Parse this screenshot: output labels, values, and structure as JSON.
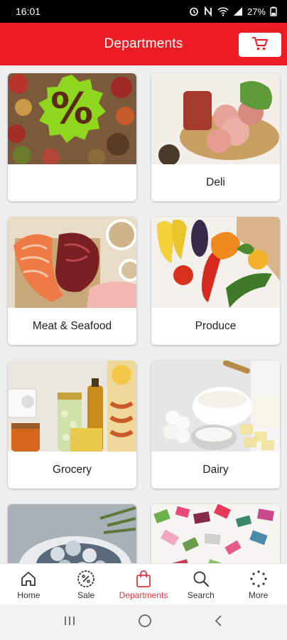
{
  "status_bar": {
    "time": "16:01",
    "battery": "27%"
  },
  "header": {
    "title": "Departments"
  },
  "departments": [
    {
      "label": ""
    },
    {
      "label": "Deli"
    },
    {
      "label": "Meat & Seafood"
    },
    {
      "label": "Produce"
    },
    {
      "label": "Grocery"
    },
    {
      "label": "Dairy"
    },
    {
      "label": ""
    },
    {
      "label": ""
    }
  ],
  "sale_badge": {
    "symbol": "%"
  },
  "bottom_nav": {
    "items": [
      {
        "label": "Home",
        "icon": "home-icon"
      },
      {
        "label": "Sale",
        "icon": "sale-icon"
      },
      {
        "label": "Departments",
        "icon": "bag-icon"
      },
      {
        "label": "Search",
        "icon": "search-icon"
      },
      {
        "label": "More",
        "icon": "more-icon"
      }
    ],
    "active": "Departments"
  },
  "colors": {
    "brand_red": "#ec1c24",
    "active_nav": "#e0353b",
    "sale_green": "#8fd61f"
  }
}
